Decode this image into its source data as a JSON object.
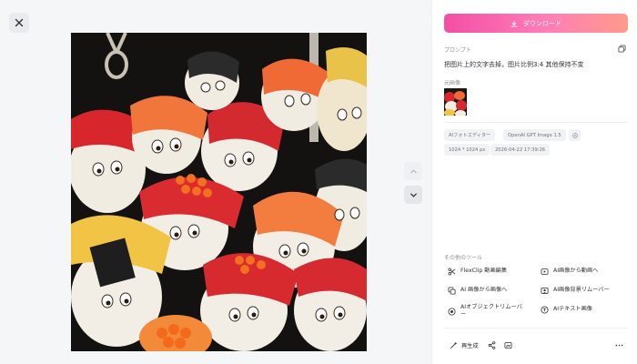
{
  "viewer": {
    "close_icon": "close-icon",
    "image_description_alt": "",
    "nav_up_icon": "chevron-up-icon",
    "nav_down_icon": "chevron-down-icon"
  },
  "panel": {
    "download_label": "ダウンロード",
    "prompt_label": "プロンプト",
    "prompt_text": "把图片上的文字去掉，图片比例3:4 其他保持不变",
    "source_label": "元画像",
    "tags": [
      "AIフォトエディター",
      "OpenAI GPT Image 1.5",
      "1024 * 1024 px",
      "2026-04-22 17:39:26"
    ],
    "tools_label": "その他のツール",
    "tools": [
      {
        "label": "FlexClip 動画編集",
        "icon": "scissors-icon"
      },
      {
        "label": "AI画像から動画へ",
        "icon": "image-to-video-icon"
      },
      {
        "label": "AI 画像から画像へ",
        "icon": "image-to-image-icon"
      },
      {
        "label": "AI画像背景リムーバー",
        "icon": "background-remover-icon"
      },
      {
        "label": "AIオブジェクトリムーバー",
        "icon": "object-remover-icon"
      },
      {
        "label": "AIテキスト画像",
        "icon": "text-to-image-icon"
      }
    ],
    "bottom": {
      "regenerate_label": "再生成"
    },
    "colors": {
      "download_gradient_start": "#f24fa4",
      "download_gradient_end": "#ff9a8a"
    }
  }
}
